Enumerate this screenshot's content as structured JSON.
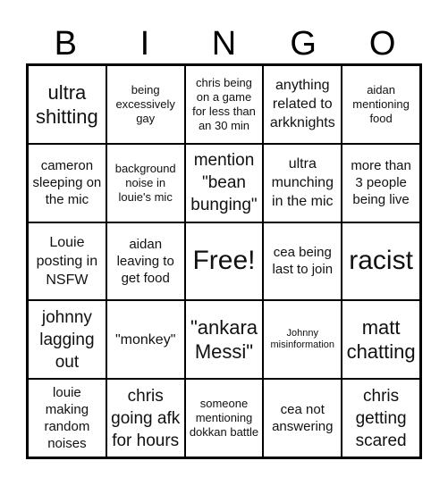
{
  "header": {
    "letters": [
      "B",
      "I",
      "N",
      "G",
      "O"
    ]
  },
  "board": {
    "cells": [
      "ultra shitting",
      "being excessively gay",
      "chris being on a game for less than an 30 min",
      "anything related to arkknights",
      "aidan mentioning food",
      "cameron sleeping on the mic",
      "background noise in louie's mic",
      "mention \"bean bunging\"",
      "ultra munching in the mic",
      "more than 3 people being live",
      "Louie posting in NSFW",
      "aidan leaving to get food",
      "Free!",
      "cea being last to join",
      "racist",
      "johnny lagging out",
      "\"monkey\"",
      "\"ankara Messi\"",
      "Johnny misinformation",
      "matt chatting",
      "louie making random noises",
      "chris going afk for hours",
      "someone mentioning dokkan battle",
      "cea not answering",
      "chris getting scared"
    ]
  }
}
